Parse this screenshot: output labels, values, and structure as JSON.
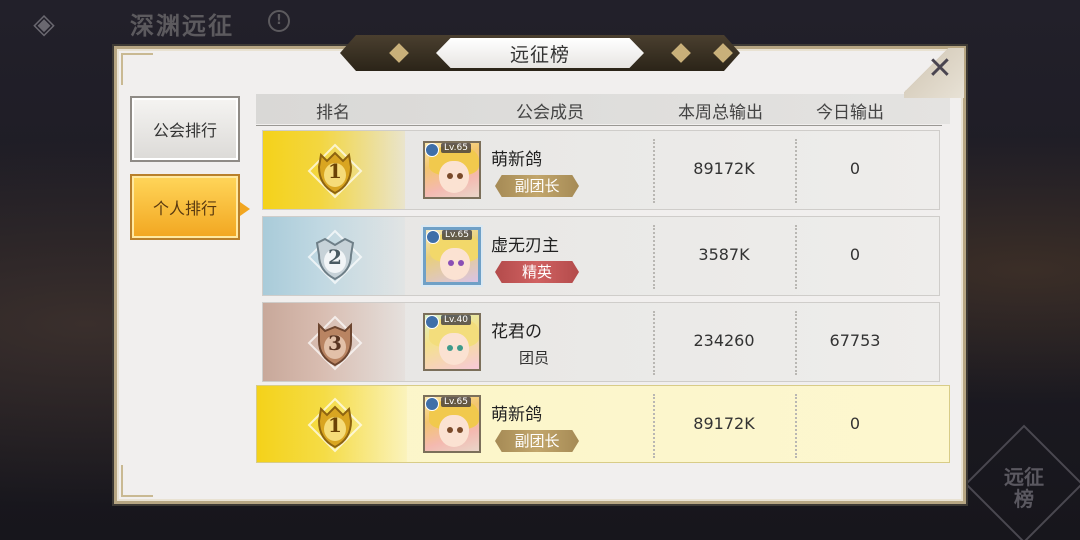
{
  "screen": {
    "title": "深渊远征",
    "info_icon": "info-icon",
    "back_icon": "back-diamond-icon",
    "corner_button": "远征榜"
  },
  "dialog": {
    "title": "远征榜",
    "close_icon": "close-icon"
  },
  "tabs": [
    {
      "label": "公会排行",
      "active": false
    },
    {
      "label": "个人排行",
      "active": true
    }
  ],
  "table": {
    "headers": [
      "排名",
      "公会成员",
      "本周总输出",
      "今日输出"
    ],
    "rows": [
      {
        "rank": "1",
        "level": "Lv.65",
        "name": "萌新鸽",
        "role": "副团长",
        "weekly": "89172K",
        "today": "0"
      },
      {
        "rank": "2",
        "level": "Lv.65",
        "name": "虚无刃主",
        "role": "精英",
        "weekly": "3587K",
        "today": "0"
      },
      {
        "rank": "3",
        "level": "Lv.40",
        "name": "花君の",
        "role": "团员",
        "weekly": "234260",
        "today": "67753"
      }
    ],
    "self": {
      "rank": "1",
      "level": "Lv.65",
      "name": "萌新鸽",
      "role": "副团长",
      "weekly": "89172K",
      "today": "0"
    }
  },
  "colors": {
    "gold": "#f4d21a",
    "silver": "#a9cbd9",
    "bronze": "#c8a89a",
    "vice_badge": "#b29863",
    "elite_badge": "#c25656",
    "active_tab": "#f5b73a"
  }
}
